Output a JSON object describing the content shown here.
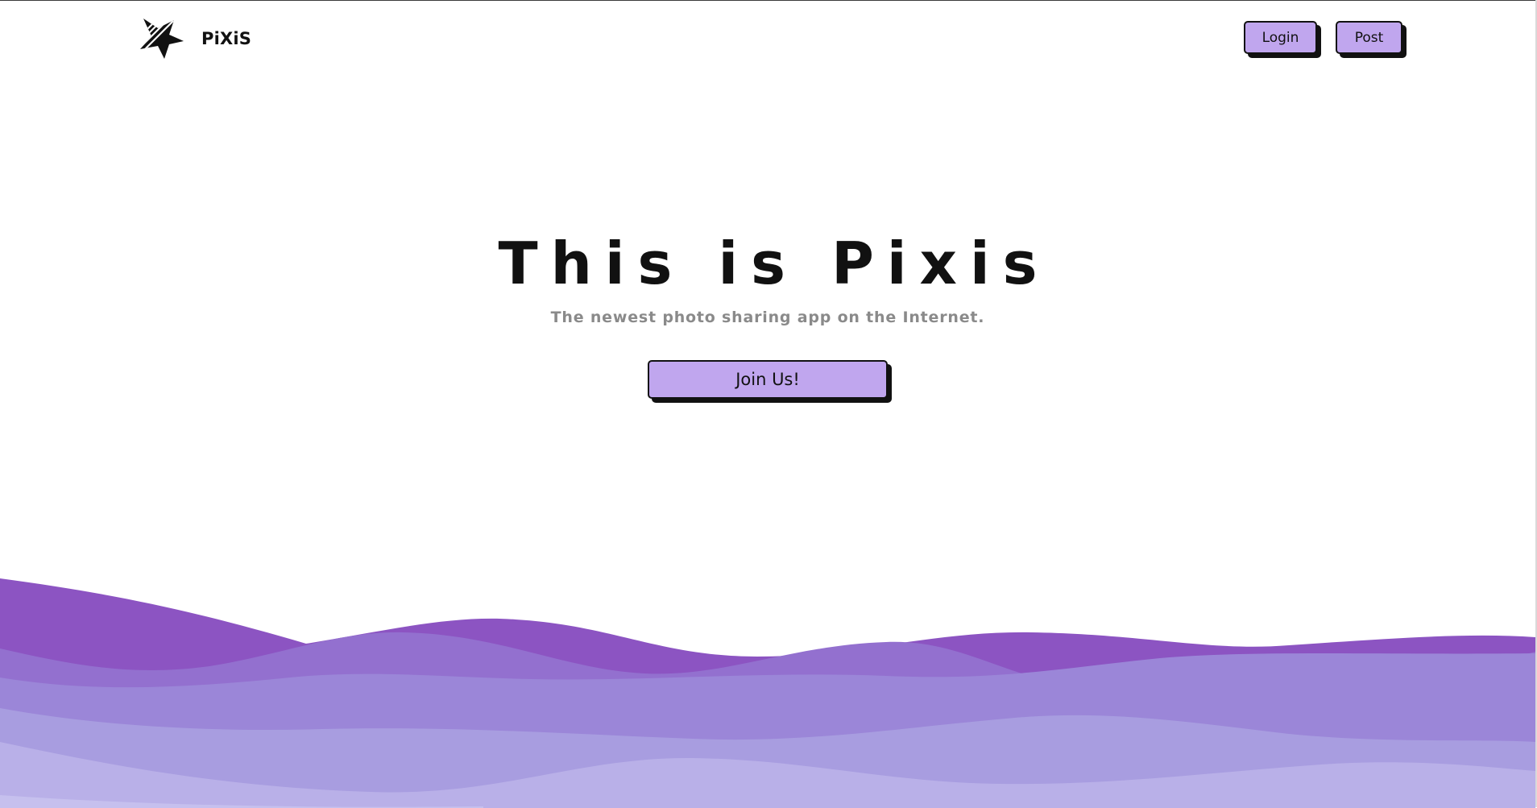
{
  "header": {
    "brand": "PiXiS",
    "login_label": "Login",
    "post_label": "Post"
  },
  "hero": {
    "title": "This is Pixis",
    "subtitle": "The newest photo sharing app on the Internet.",
    "cta_label": "Join Us!"
  },
  "colors": {
    "button_fill": "#c0a6ee",
    "text": "#111111",
    "subtitle": "#8a8a8a",
    "wave_colors": [
      "#8c54c2",
      "#9370cf",
      "#9b86d8",
      "#a89de0",
      "#b9b0e8"
    ]
  },
  "icons": {
    "logo": "striped-star-logo-icon"
  }
}
